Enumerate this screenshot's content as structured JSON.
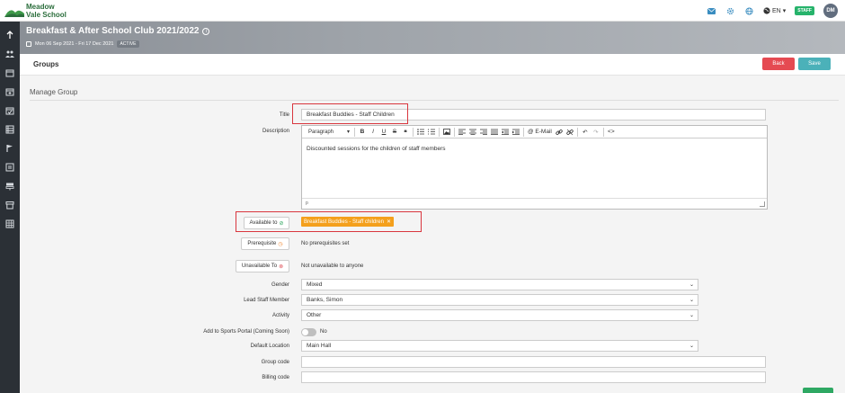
{
  "brand": {
    "name_line1": "Meadow",
    "name_line2": "Vale School"
  },
  "topbar": {
    "language": "EN",
    "staff_badge": "STAFF",
    "avatar_initials": "DM"
  },
  "header": {
    "title": "Breakfast & After School Club 2021/2022",
    "date_range": "Mon 06 Sep 2021 - Fri 17 Dec 2021",
    "status_badge": "ACTIVE"
  },
  "groups_bar": {
    "title": "Groups",
    "back_label": "Back",
    "save_label": "Save"
  },
  "manage": {
    "section_title": "Manage Group",
    "title_label": "Title",
    "title_value": "Breakfast Buddies - Staff Children",
    "description_label": "Description",
    "editor": {
      "block_format": "Paragraph",
      "email_button": "E-Mail",
      "body": "Discounted sessions for the children of staff members",
      "status_path": "p"
    },
    "available_to_label": "Available to",
    "available_to_tag": "Breakfast Buddies - Staff children",
    "prerequisite_label": "Prerequisite",
    "prerequisite_value": "No prerequisites set",
    "unavailable_label": "Unavailable To",
    "unavailable_value": "Not unavailable to anyone",
    "gender_label": "Gender",
    "gender_value": "Mixed",
    "lead_staff_label": "Lead Staff Member",
    "lead_staff_value": "Banks, Simon",
    "activity_label": "Activity",
    "activity_value": "Other",
    "sports_portal_label": "Add to Sports Portal (Coming Soon)",
    "sports_portal_value": "No",
    "location_label": "Default Location",
    "location_value": "Main Hall",
    "group_code_label": "Group code",
    "group_code_value": "",
    "billing_code_label": "Billing code",
    "billing_code_value": ""
  },
  "colors": {
    "sidebar": "#2b3036",
    "back_button": "#e54a52",
    "save_button": "#4bb1b9",
    "tag": "#f4a01c",
    "highlight": "#d9363e",
    "staff_badge": "#26b36b"
  }
}
